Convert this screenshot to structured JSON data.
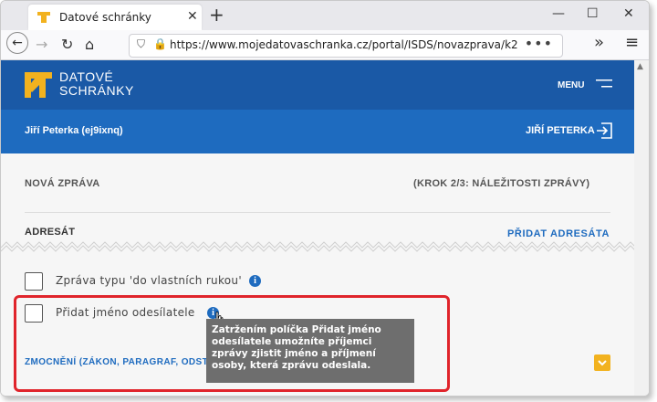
{
  "browser": {
    "tab_title": "Datové schránky",
    "tab_close": "✕",
    "new_tab": "+",
    "url": "https://www.mojedatovaschranka.cz/portal/ISDS/novazprava/k2",
    "url_menu": "•••",
    "overflow": "»",
    "hamburger": "≡",
    "minimize": "—",
    "maximize": "☐",
    "close": "✕"
  },
  "header": {
    "logo_line1": "DATOVÉ",
    "logo_line2": "SCHRÁNKY",
    "menu_label": "MENU"
  },
  "userbar": {
    "user_left": "Jiří Peterka (ej9ixnq)",
    "user_right": "JIŘÍ PETERKA"
  },
  "content": {
    "section_title": "NOVÁ ZPRÁVA",
    "step": "(KROK 2/3: NÁLEŽITOSTI ZPRÁVY)",
    "adresat": "ADRESÁT",
    "pridat_adresata": "PŘIDAT ADRESÁTA",
    "checkbox_own_hands": "Zpráva typu 'do vlastních rukou'",
    "checkbox_sender_name": "Přidat jméno odesílatele",
    "zmocneni": "ZMOCNĚNÍ (ZÁKON, PARAGRAF, ODSTA",
    "tooltip": "Zatržením políčka Přidat jméno odesílatele umožníte příjemci zprávy zjistit jméno a příjmení osoby, která zprávu odeslala."
  },
  "colors": {
    "header_blue": "#1a59a6",
    "userbar_blue": "#1e6bbf",
    "logo_yellow": "#f2b21f",
    "highlight_red": "#e0242b"
  },
  "icons": {
    "info": "i"
  }
}
